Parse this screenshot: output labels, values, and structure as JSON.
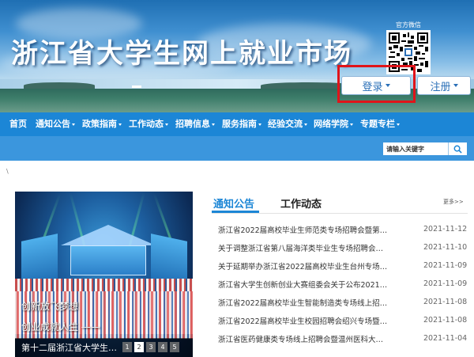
{
  "banner": {
    "title": "浙江省大学生网上就业市场",
    "qr_label": "官方微信",
    "login_label": "登录",
    "register_label": "注册"
  },
  "nav": {
    "items": [
      {
        "label": "首页",
        "dropdown": false
      },
      {
        "label": "通知公告",
        "dropdown": true
      },
      {
        "label": "政策指南",
        "dropdown": true
      },
      {
        "label": "工作动态",
        "dropdown": true
      },
      {
        "label": "招聘信息",
        "dropdown": true
      },
      {
        "label": "服务指南",
        "dropdown": true
      },
      {
        "label": "经验交流",
        "dropdown": true
      },
      {
        "label": "网络学院",
        "dropdown": true
      },
      {
        "label": "专题专栏",
        "dropdown": true
      }
    ]
  },
  "search": {
    "placeholder": "请输入关键字"
  },
  "breadcrumb": "\\",
  "slider": {
    "line1": "创新放飞梦想",
    "line2": "创业成就人生 ——",
    "caption": "第十二届浙江省大学生…",
    "pages": [
      "1",
      "2",
      "3",
      "4",
      "5"
    ],
    "active_page": "2"
  },
  "news": {
    "tab_notice": "通知公告",
    "tab_work": "工作动态",
    "more": "更多>>",
    "items": [
      {
        "title": "浙江省2022届高校毕业生师范类专场招聘会暨第…",
        "date": "2021-11-12"
      },
      {
        "title": "关于调整浙江省第八届海洋类毕业生专场招聘会…",
        "date": "2021-11-10"
      },
      {
        "title": "关于延期举办浙江省2022届高校毕业生台州专场…",
        "date": "2021-11-09"
      },
      {
        "title": "浙江省大学生创新创业大赛组委会关于公布2021…",
        "date": "2021-11-09"
      },
      {
        "title": "浙江省2022届高校毕业生智能制造类专场线上招…",
        "date": "2021-11-08"
      },
      {
        "title": "浙江省2022届高校毕业生校园招聘会绍兴专场暨…",
        "date": "2021-11-08"
      },
      {
        "title": "浙江省医药健康类专场线上招聘会暨温州医科大…",
        "date": "2021-11-04"
      }
    ]
  },
  "colors": {
    "nav_bg": "#1c86d6",
    "accent": "#1c86d6",
    "highlight_box": "#e0141a"
  }
}
